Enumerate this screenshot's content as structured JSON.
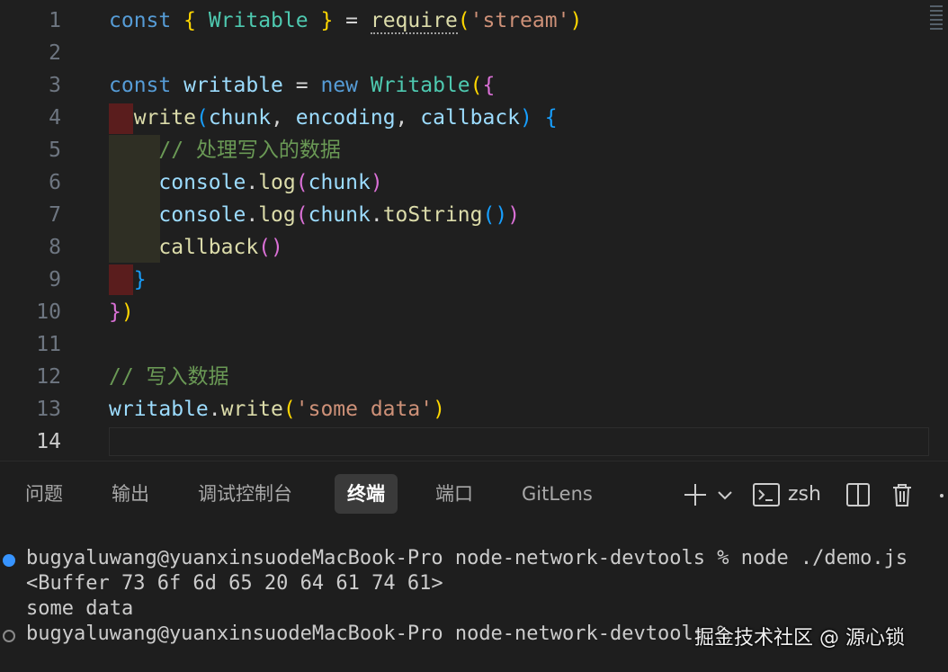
{
  "editor": {
    "active_line": "14",
    "lines": [
      {
        "num": "1",
        "tokens": [
          {
            "t": "const",
            "c": "kw"
          },
          {
            "t": " ",
            "c": "op"
          },
          {
            "t": "{",
            "c": "p1"
          },
          {
            "t": " Writable ",
            "c": "cls"
          },
          {
            "t": "}",
            "c": "p1"
          },
          {
            "t": " = ",
            "c": "op"
          },
          {
            "t": "require",
            "c": "fn"
          },
          {
            "t": "(",
            "c": "p1"
          },
          {
            "t": "'stream'",
            "c": "str"
          },
          {
            "t": ")",
            "c": "p1"
          }
        ]
      },
      {
        "num": "2",
        "tokens": []
      },
      {
        "num": "3",
        "tokens": [
          {
            "t": "const",
            "c": "kw"
          },
          {
            "t": " ",
            "c": "op"
          },
          {
            "t": "writable",
            "c": "var"
          },
          {
            "t": " = ",
            "c": "op"
          },
          {
            "t": "new",
            "c": "kw"
          },
          {
            "t": " ",
            "c": "op"
          },
          {
            "t": "Writable",
            "c": "cls"
          },
          {
            "t": "(",
            "c": "p1"
          },
          {
            "t": "{",
            "c": "p2"
          }
        ]
      },
      {
        "num": "4",
        "tokens": [
          {
            "t": "  ",
            "c": "op"
          },
          {
            "t": "write",
            "c": "fn"
          },
          {
            "t": "(",
            "c": "p3"
          },
          {
            "t": "chunk",
            "c": "var"
          },
          {
            "t": ", ",
            "c": "op"
          },
          {
            "t": "encoding",
            "c": "var"
          },
          {
            "t": ", ",
            "c": "op"
          },
          {
            "t": "callback",
            "c": "var"
          },
          {
            "t": ")",
            "c": "p3"
          },
          {
            "t": " ",
            "c": "op"
          },
          {
            "t": "{",
            "c": "p3"
          }
        ]
      },
      {
        "num": "5",
        "tokens": [
          {
            "t": "    ",
            "c": "op"
          },
          {
            "t": "// 处理写入的数据",
            "c": "cmt"
          }
        ]
      },
      {
        "num": "6",
        "tokens": [
          {
            "t": "    ",
            "c": "op"
          },
          {
            "t": "console",
            "c": "var"
          },
          {
            "t": ".",
            "c": "op"
          },
          {
            "t": "log",
            "c": "fn"
          },
          {
            "t": "(",
            "c": "p2"
          },
          {
            "t": "chunk",
            "c": "var"
          },
          {
            "t": ")",
            "c": "p2"
          }
        ]
      },
      {
        "num": "7",
        "tokens": [
          {
            "t": "    ",
            "c": "op"
          },
          {
            "t": "console",
            "c": "var"
          },
          {
            "t": ".",
            "c": "op"
          },
          {
            "t": "log",
            "c": "fn"
          },
          {
            "t": "(",
            "c": "p2"
          },
          {
            "t": "chunk",
            "c": "var"
          },
          {
            "t": ".",
            "c": "op"
          },
          {
            "t": "toString",
            "c": "fn"
          },
          {
            "t": "(",
            "c": "p3"
          },
          {
            "t": ")",
            "c": "p3"
          },
          {
            "t": ")",
            "c": "p2"
          }
        ]
      },
      {
        "num": "8",
        "tokens": [
          {
            "t": "    ",
            "c": "op"
          },
          {
            "t": "callback",
            "c": "fn"
          },
          {
            "t": "(",
            "c": "p2"
          },
          {
            "t": ")",
            "c": "p2"
          }
        ]
      },
      {
        "num": "9",
        "tokens": [
          {
            "t": "  ",
            "c": "op"
          },
          {
            "t": "}",
            "c": "p3"
          }
        ]
      },
      {
        "num": "10",
        "tokens": [
          {
            "t": "}",
            "c": "p2"
          },
          {
            "t": ")",
            "c": "p1"
          }
        ]
      },
      {
        "num": "11",
        "tokens": []
      },
      {
        "num": "12",
        "tokens": [
          {
            "t": "// 写入数据",
            "c": "cmt"
          }
        ]
      },
      {
        "num": "13",
        "tokens": [
          {
            "t": "writable",
            "c": "var"
          },
          {
            "t": ".",
            "c": "op"
          },
          {
            "t": "write",
            "c": "fn"
          },
          {
            "t": "(",
            "c": "p1"
          },
          {
            "t": "'some data'",
            "c": "str"
          },
          {
            "t": ")",
            "c": "p1"
          }
        ]
      },
      {
        "num": "14",
        "tokens": []
      }
    ]
  },
  "panel": {
    "tabs": [
      {
        "label": "问题"
      },
      {
        "label": "输出"
      },
      {
        "label": "调试控制台"
      },
      {
        "label": "终端",
        "active": true
      },
      {
        "label": "端口"
      },
      {
        "label": "GitLens"
      }
    ],
    "tools": {
      "add_icon": "plus-icon",
      "dropdown_icon": "chevron-down-icon",
      "shell_icon": "terminal-icon",
      "shell_name": "zsh",
      "split_icon": "split-icon",
      "trash_icon": "trash-icon",
      "more_icon": "more-icon"
    }
  },
  "terminal": {
    "lines": [
      {
        "text": "bugyaluwang@yuanxinsuodeMacBook-Pro node-network-devtools % node ./demo.js",
        "marker": "ok"
      },
      {
        "text": "<Buffer 73 6f 6d 65 20 64 61 74 61>"
      },
      {
        "text": "some data"
      },
      {
        "text": "bugyaluwang@yuanxinsuodeMacBook-Pro node-network-devtools % ",
        "marker": "idle"
      }
    ]
  },
  "watermark": "掘金技术社区 @ 源心锁",
  "colors": {
    "background": "#1f1f1f",
    "keyword": "#569cd6",
    "class": "#4ec9b0",
    "variable": "#9cdcfe",
    "function": "#dcdcaa",
    "string": "#ce9178",
    "comment": "#6a9955",
    "bracket_1": "#ffd700",
    "bracket_2": "#da70d6",
    "bracket_3": "#179fff",
    "terminal_success_dot": "#3794ff"
  }
}
